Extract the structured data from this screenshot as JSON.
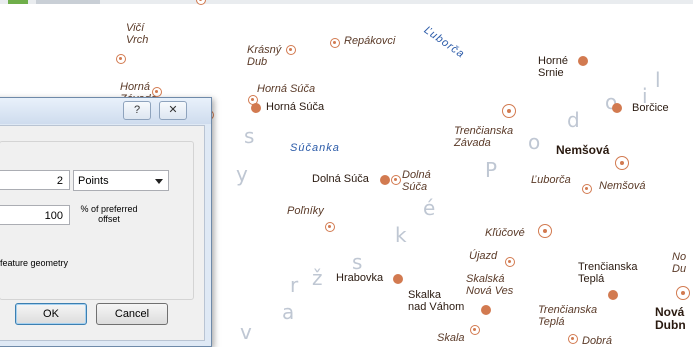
{
  "map": {
    "places": [
      {
        "id": "vici-vrch",
        "text": "Vičí\nVrch"
      },
      {
        "id": "krasny-dub",
        "text": "Krásný\nDub"
      },
      {
        "id": "repakovci",
        "text": "Repákovci"
      },
      {
        "id": "horna-zavada-partial",
        "text": "Horná\nZávadá"
      },
      {
        "id": "horna-suca-italic",
        "text": "Horná Súča"
      },
      {
        "id": "horna-suca",
        "text": "Horná Súča"
      },
      {
        "id": "horne-srnie",
        "text": "Horné\nSrnie"
      },
      {
        "id": "borcice",
        "text": "Borčice"
      },
      {
        "id": "trencianska-zavada",
        "text": "Trenčianska\nZávada"
      },
      {
        "id": "nemsova-bold",
        "text": "Nemšová"
      },
      {
        "id": "luborca",
        "text": "Ľuborča"
      },
      {
        "id": "nemsova",
        "text": "Nemšová"
      },
      {
        "id": "dolna-suca",
        "text": "Dolná Súča"
      },
      {
        "id": "dolna-suca-italic",
        "text": "Dolná\nSúča"
      },
      {
        "id": "polniky",
        "text": "Poľníky"
      },
      {
        "id": "klucove",
        "text": "Kľúčové"
      },
      {
        "id": "ujazd",
        "text": "Újazd"
      },
      {
        "id": "hrabovka",
        "text": "Hrabovka"
      },
      {
        "id": "skalska-nova-ves",
        "text": "Skalská\nNová Ves"
      },
      {
        "id": "skalka-nad-vahom",
        "text": "Skalka\nnad Váhom"
      },
      {
        "id": "trencianska-tepla",
        "text": "Trenčianska\nTeplá"
      },
      {
        "id": "trencianska-tepla-italic",
        "text": "Trenčianska\nTeplá"
      },
      {
        "id": "nova-dubnica",
        "text": "Nová\nDubn"
      },
      {
        "id": "no-du",
        "text": "No\nDu"
      },
      {
        "id": "skala",
        "text": "Skala"
      },
      {
        "id": "dobra",
        "text": "Dobrá"
      }
    ],
    "water": {
      "suca": "Súčanka",
      "luborca_river": "Ľuborča"
    },
    "region_letters": [
      "l",
      "i",
      "o",
      "d",
      "o",
      "P",
      "y",
      "k",
      "s",
      "ž",
      "a",
      "v",
      "s",
      "é",
      "r"
    ]
  },
  "dialog": {
    "help_label": "?",
    "close_label": "✕",
    "size_value": "2",
    "units_selected": "Points",
    "offset_value": "100",
    "offset_suffix": "% of preferred\noffset",
    "checkbox_label": "feature geometry",
    "ok_label": "OK",
    "cancel_label": "Cancel"
  },
  "colors": {
    "accent": "#d27a50",
    "water": "#2a5aa8",
    "dialog_bg": "#dfe9f5"
  }
}
